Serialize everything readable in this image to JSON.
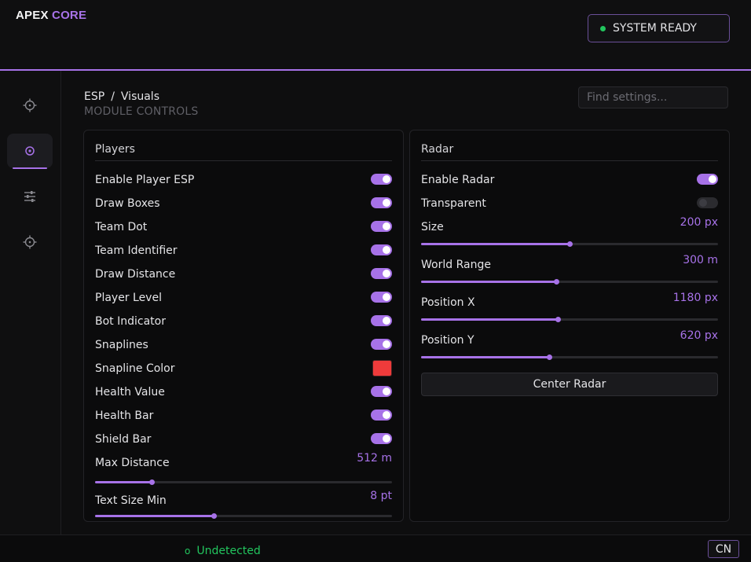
{
  "brand": {
    "part1": "APEX",
    "part2": "CORE"
  },
  "status": {
    "label": "SYSTEM READY",
    "color": "#22c55e"
  },
  "sidebar": {
    "items": [
      {
        "icon": "crosshair-icon",
        "active": false
      },
      {
        "icon": "target-icon",
        "active": true
      },
      {
        "icon": "sliders-icon",
        "active": false
      },
      {
        "icon": "crosshair-icon",
        "active": false
      }
    ]
  },
  "breadcrumb": {
    "section": "ESP",
    "separator": "/",
    "page": "Visuals"
  },
  "subtitle": "MODULE CONTROLS",
  "search": {
    "placeholder": "Find settings...",
    "value": ""
  },
  "players": {
    "title": "Players",
    "toggles": [
      {
        "label": "Enable Player ESP",
        "on": true
      },
      {
        "label": "Draw Boxes",
        "on": true
      },
      {
        "label": "Team Dot",
        "on": true
      },
      {
        "label": "Team Identifier",
        "on": true
      },
      {
        "label": "Draw Distance",
        "on": true
      },
      {
        "label": "Player Level",
        "on": true
      },
      {
        "label": "Bot Indicator",
        "on": true
      },
      {
        "label": "Snaplines",
        "on": true
      }
    ],
    "color_row": {
      "label": "Snapline Color",
      "color": "#ef3b3b"
    },
    "toggles2": [
      {
        "label": "Health Value",
        "on": true
      },
      {
        "label": "Health Bar",
        "on": true
      },
      {
        "label": "Shield Bar",
        "on": true
      }
    ],
    "sliders": [
      {
        "label": "Max Distance",
        "value": "512 m",
        "fraction": 0.19
      },
      {
        "label": "Text Size Min",
        "value": "8 pt",
        "fraction": 0.4
      }
    ]
  },
  "radar": {
    "title": "Radar",
    "toggles": [
      {
        "label": "Enable Radar",
        "on": true
      },
      {
        "label": "Transparent",
        "on": false
      }
    ],
    "sliders": [
      {
        "label": "Size",
        "value": "200 px",
        "fraction": 0.5
      },
      {
        "label": "World Range",
        "value": "300 m",
        "fraction": 0.455
      },
      {
        "label": "Position X",
        "value": "1180 px",
        "fraction": 0.46
      },
      {
        "label": "Position Y",
        "value": "620 px",
        "fraction": 0.43
      }
    ],
    "center_button": "Center Radar"
  },
  "footer": {
    "status": "Undetected",
    "status_glyph": "o",
    "language": "CN"
  },
  "colors": {
    "accent": "#a772e8",
    "ok": "#22c55e"
  }
}
